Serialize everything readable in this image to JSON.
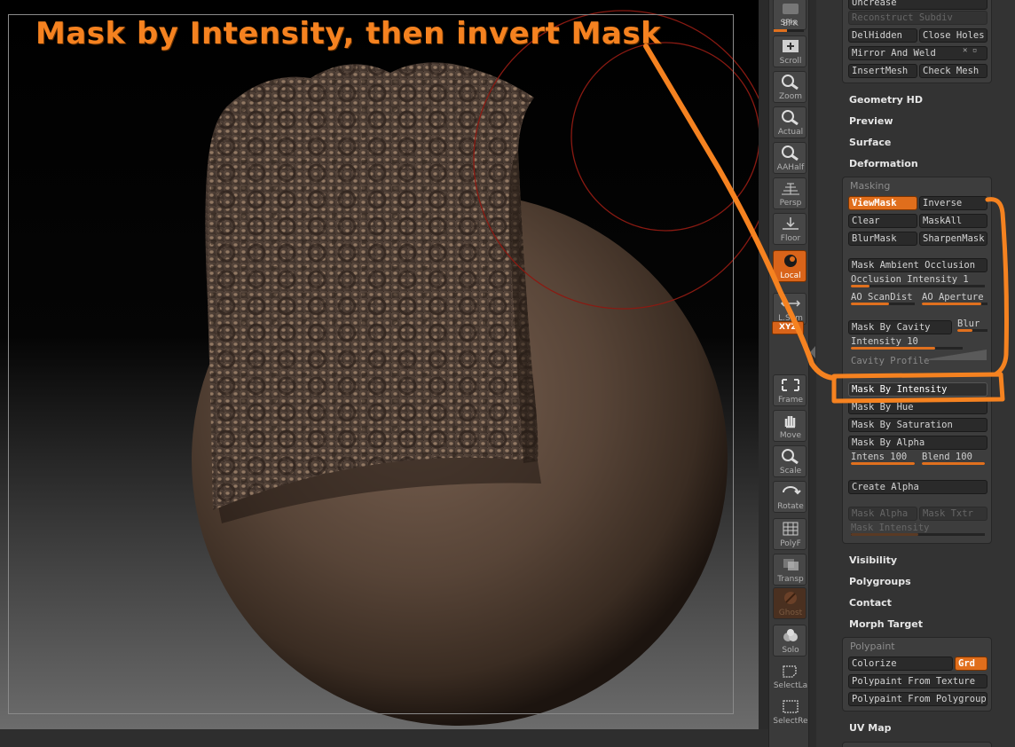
{
  "caption": "Mask by Intensity, then invert Mask",
  "accent_color": "#e06e1c",
  "dock": [
    {
      "name": "bpr-button",
      "label": "BPR",
      "icon": "bpr-icon",
      "state": "normal"
    },
    {
      "name": "scroll-button",
      "label": "Scroll",
      "icon": "scroll-icon",
      "state": "normal"
    },
    {
      "name": "zoom-button",
      "label": "Zoom",
      "icon": "zoom-icon",
      "state": "normal"
    },
    {
      "name": "actual-button",
      "label": "Actual",
      "icon": "actual-icon",
      "state": "normal"
    },
    {
      "name": "aahalf-button",
      "label": "AAHalf",
      "icon": "aahalf-icon",
      "state": "normal"
    },
    {
      "name": "persp-button",
      "label": "Persp",
      "icon": "perspective-grid-icon",
      "state": "normal"
    },
    {
      "name": "floor-button",
      "label": "Floor",
      "icon": "floor-icon",
      "state": "normal"
    },
    {
      "name": "local-button",
      "label": "Local",
      "icon": "local-icon",
      "state": "active"
    },
    {
      "name": "lsym-button",
      "label": "L.Sym",
      "icon": "symmetry-icon",
      "state": "normal"
    },
    {
      "name": "frame-button",
      "label": "Frame",
      "icon": "frame-icon",
      "state": "normal"
    },
    {
      "name": "move-button",
      "label": "Move",
      "icon": "hand-icon",
      "state": "normal"
    },
    {
      "name": "scale-button",
      "label": "Scale",
      "icon": "scale-icon",
      "state": "normal"
    },
    {
      "name": "rotate-button",
      "label": "Rotate",
      "icon": "rotate-icon",
      "state": "normal"
    },
    {
      "name": "polyf-button",
      "label": "PolyF",
      "icon": "polyframe-grid-icon",
      "state": "normal"
    },
    {
      "name": "transp-button",
      "label": "Transp",
      "icon": "transparency-icon",
      "state": "normal"
    },
    {
      "name": "ghost-button",
      "label": "Ghost",
      "icon": "ghost-icon",
      "state": "dim"
    },
    {
      "name": "solo-button",
      "label": "Solo",
      "icon": "solo-icon",
      "state": "normal"
    },
    {
      "name": "selectlasso-button",
      "label": "SelectLa",
      "icon": "lasso-icon",
      "state": "plain"
    },
    {
      "name": "selectrect-button",
      "label": "SelectRe",
      "icon": "select-rect-icon",
      "state": "plain"
    }
  ],
  "spix_label": "SPix",
  "spix_value": 0.45,
  "xyz_label": "XYZ",
  "geometry": {
    "top_buttons": [
      "Uncrease",
      "Reconstruct Subdiv",
      "DelHidden",
      "Close Holes",
      "Mirror And Weld",
      "InsertMesh",
      "Check Mesh"
    ]
  },
  "subpalettes": {
    "geometry_hd": "Geometry HD",
    "preview": "Preview",
    "surface": "Surface",
    "deformation": "Deformation",
    "visibility": "Visibility",
    "polygroups": "Polygroups",
    "contact": "Contact",
    "morph_target": "Morph Target",
    "uv_map": "UV Map"
  },
  "masking": {
    "title": "Masking",
    "viewmask": "ViewMask",
    "inverse": "Inverse",
    "clear": "Clear",
    "maskall": "MaskAll",
    "blurmask": "BlurMask",
    "sharpenmask": "SharpenMask",
    "mask_ambient_occlusion": "Mask Ambient Occlusion",
    "occlusion_intensity": {
      "label": "Occlusion Intensity 1",
      "value": 0.14
    },
    "ao_scandist": {
      "label": "AO ScanDist",
      "value": 0.6
    },
    "ao_aperture": {
      "label": "AO Aperture",
      "value": 0.9
    },
    "mask_by_cavity": "Mask By Cavity",
    "blur": {
      "label": "Blur",
      "value": 0.5
    },
    "intensity": {
      "label": "Intensity 10",
      "value": 0.75
    },
    "cavity_profile": "Cavity Profile",
    "mask_by_intensity": "Mask By Intensity",
    "mask_by_hue": "Mask By Hue",
    "mask_by_saturation": "Mask By Saturation",
    "mask_by_alpha": "Mask By Alpha",
    "intens": {
      "label": "Intens 100",
      "value": 1.0
    },
    "blend": {
      "label": "Blend 100",
      "value": 1.0
    },
    "create_alpha": "Create Alpha",
    "mask_alpha": "Mask Alpha",
    "mask_txtr": "Mask Txtr",
    "mask_intensity": {
      "label": "Mask Intensity",
      "value": 0.5
    }
  },
  "polypaint": {
    "title": "Polypaint",
    "colorize": "Colorize",
    "grd": "Grd",
    "from_texture": "Polypaint From Texture",
    "from_polygroup": "Polypaint From Polygroup"
  }
}
